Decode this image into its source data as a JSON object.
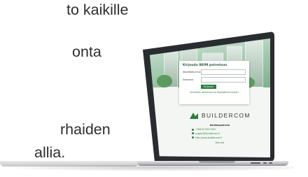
{
  "background_text": {
    "line1": "to kaikille",
    "line2": "onta",
    "line3": "rhaiden",
    "line4": "allia."
  },
  "laptop_screen": {
    "login_title": "Kirjaudu BEIM palveluun",
    "username_label": "Käyttäjätunnus",
    "password_label": "Salasana",
    "login_button": "Kirjaudu",
    "forgot_link": "Unohditko salasanasi tai käyttäjätunnuksesi?",
    "brand_name": "BUILDERCOM",
    "contact_header": "Asiakaspalvelu",
    "phone": "+358 40 555 0000",
    "email": "support@buildercom.fi",
    "web": "http://www.buildercom.fi",
    "social": "Seuraa"
  },
  "colors": {
    "accent": "#2f7d3e",
    "text": "#2e2e2e"
  }
}
